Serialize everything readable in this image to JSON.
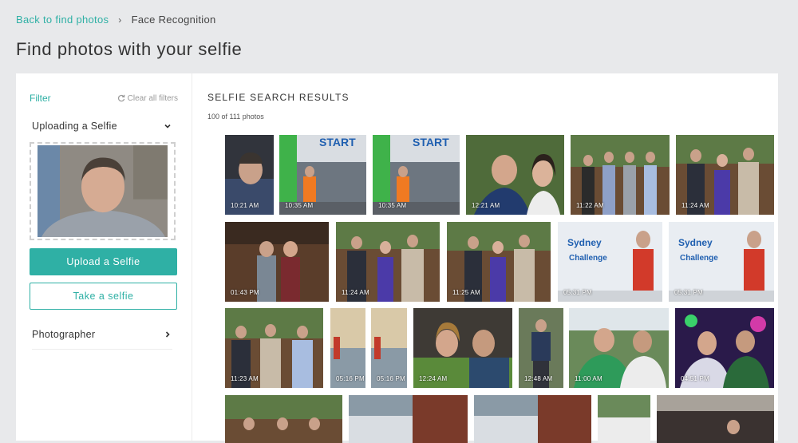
{
  "breadcrumb": {
    "back_label": "Back to find photos",
    "current": "Face Recognition"
  },
  "page_title": "Find photos with your selfie",
  "sidebar": {
    "filter_label": "Filter",
    "clear_filters": "Clear all filters",
    "uploading_section": "Uploading a Selfie",
    "upload_button": "Upload a Selfie",
    "take_button": "Take a selfie",
    "photographer_section": "Photographer"
  },
  "results": {
    "title": "SELFIE SEARCH RESULTS",
    "count": "100 of 111 photos",
    "photos": [
      {
        "time": "10:21 AM"
      },
      {
        "time": "10:35 AM"
      },
      {
        "time": "10:35 AM"
      },
      {
        "time": "12:21 AM"
      },
      {
        "time": "11:22 AM"
      },
      {
        "time": "11:24 AM"
      },
      {
        "time": "01:43 PM"
      },
      {
        "time": "11:24 AM"
      },
      {
        "time": "11:25 AM"
      },
      {
        "time": "05:31 PM"
      },
      {
        "time": "05:31 PM"
      },
      {
        "time": "11:23 AM"
      },
      {
        "time": "05:16 PM"
      },
      {
        "time": "05:16 PM"
      },
      {
        "time": "12:24 AM"
      },
      {
        "time": "12:48 AM"
      },
      {
        "time": "11:00 AM"
      },
      {
        "time": "04:51 PM"
      },
      {
        "time": ""
      },
      {
        "time": ""
      },
      {
        "time": ""
      },
      {
        "time": ""
      },
      {
        "time": ""
      }
    ]
  },
  "colors": {
    "accent": "#2fb0a5",
    "page_bg": "#e8e9eb",
    "panel_bg": "#ffffff"
  },
  "icons": {
    "refresh": "refresh-icon",
    "chevron_down": "chevron-down-icon",
    "chevron_right": "chevron-right-icon",
    "breadcrumb_sep": "chevron-right-icon"
  }
}
